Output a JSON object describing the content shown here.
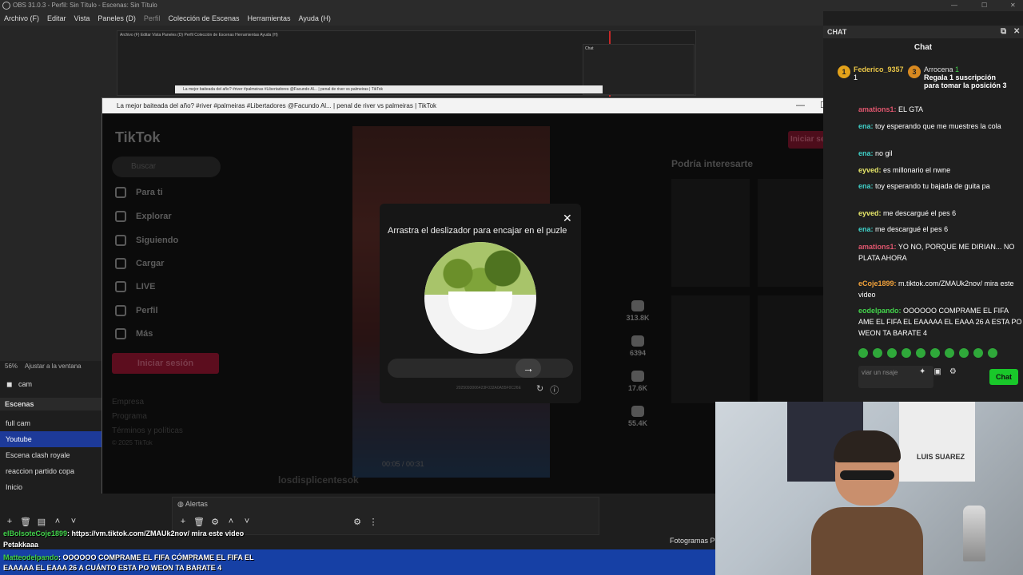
{
  "obs": {
    "title": "OBS 31.0.3 - Perfil: Sin Título - Escenas: Sin Título",
    "menu": [
      "Archivo (F)",
      "Editar",
      "Vista",
      "Paneles (D)",
      "Perfil",
      "Colección de Escenas",
      "Herramientas",
      "Ayuda (H)"
    ],
    "zoom": "56%",
    "zoom_mode": "Ajustar a la ventana",
    "source": "cam",
    "scenes_header": "Escenas",
    "scenes": [
      "full cam",
      "Youtube",
      "Escena clash royale",
      "reaccion partido copa",
      "Inicio"
    ],
    "selected_scene": "Youtube",
    "alertas": "Alertas",
    "fotogramas": "Fotogramas P",
    "nested_menu": "Archivo (F)   Editar   Vista   Paneles (D)   Perfil   Colección de Escenas   Herramientas   Ayuda (H)",
    "nested_tab": "La mejor baiteada del año? #river #palmeiras #Libertadores @Facundo Al... | penal de river vs palmeiras | TikTok"
  },
  "browser": {
    "title": "La mejor baiteada del año? #river #palmeiras #Libertadores @Facundo Al... | penal de river vs palmeiras | TikTok"
  },
  "tiktok": {
    "logo": "TikTok",
    "search_placeholder": "Buscar",
    "nav": [
      "Para ti",
      "Explorar",
      "Siguiendo",
      "Cargar",
      "LIVE",
      "Perfil",
      "Más"
    ],
    "login": "Iniciar sesión",
    "footer": [
      "Empresa",
      "Programa",
      "Términos y políticas",
      "© 2025 TikTok"
    ],
    "signin_top": "Iniciar sesión",
    "suggest_title": "Podría interesarte",
    "time": "00:05 / 00:31",
    "stats": [
      "313.8K",
      "6394",
      "17.6K",
      "55.4K"
    ],
    "username": "losdisplicentesok"
  },
  "captcha": {
    "title": "Arrastra el deslizador para encajar en el puzle",
    "code": "2025093006423F032A0A55F0C26E"
  },
  "chat": {
    "panel_title": "CHAT",
    "header": "Chat",
    "gift_user": "Federico_9357",
    "gift_count": "1",
    "gift_user2": "Arrocena",
    "gift_count2": "1",
    "gift_text": "Regala 1 suscripción para tomar la posición 3",
    "messages": [
      {
        "name": "amations1:",
        "text": " EL GTA",
        "color": "#e0566e"
      },
      {
        "name": "ena:",
        "text": " toy esperando que me muestres la cola",
        "color": "#3fd1c9"
      },
      {
        "name": "ena:",
        "text": " no gil",
        "color": "#3fd1c9"
      },
      {
        "name": "eyved:",
        "text": " es millonario el nwne",
        "color": "#e8e86a"
      },
      {
        "name": "ena:",
        "text": " toy esperando tu bajada de guita pa",
        "color": "#3fd1c9"
      },
      {
        "name": "eyved:",
        "text": " me descargué el pes 6",
        "color": "#e8e86a"
      },
      {
        "name": "ena:",
        "text": " me descargué el pes 6",
        "color": "#3fd1c9"
      },
      {
        "name": "amations1:",
        "text": " YO NO, PORQUE ME DIRIAN... NO PLATA AHORA",
        "color": "#e0566e"
      },
      {
        "name": "eCoje1899:",
        "text": " m.tiktok.com/ZMAUk2nov/ mira este video",
        "color": "#f2a23b"
      },
      {
        "name": "eodelpando:",
        "text": " OOOOOO COMPRAME EL FIFA AME EL FIFA EL EAAAAA EL EAAA 26 A ESTA PO WEON TA BARATE 4",
        "color": "#42d34b"
      }
    ],
    "input_placeholder": "viar un nsaje",
    "send": "Chat"
  },
  "overlay": [
    {
      "user": "elBolsoteCoje1899",
      "text": ": https://vm.tiktok.com/ZMAUk2nov/ mira este video"
    },
    {
      "user": "",
      "text": "Petakkaaa"
    },
    {
      "user": "Matteodelpando",
      "text": ": OOOOOO COMPRAME EL FIFA CÓMPRAME EL FIFA EL"
    },
    {
      "user": "",
      "text": "EAAAAA EL EAAA 26 A CUÁNTO ESTA PO WEON TA BARATE 4"
    }
  ],
  "webcam": {
    "poster_text": "LUIS SUAREZ"
  }
}
